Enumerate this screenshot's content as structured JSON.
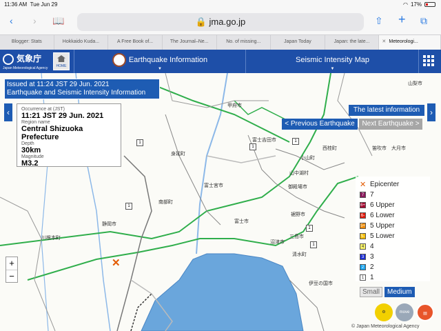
{
  "status_bar": {
    "time": "11:36 AM",
    "date": "Tue Jun 29",
    "battery": "17%"
  },
  "browser": {
    "url": "jma.go.jp",
    "tabs": [
      {
        "label": "Blogger: Stats"
      },
      {
        "label": "Hokkaido Kuda..."
      },
      {
        "label": "A Free Book of..."
      },
      {
        "label": "The Journal–Ne..."
      },
      {
        "label": "No. of missing..."
      },
      {
        "label": "Japan Today"
      },
      {
        "label": "Japan: the late..."
      },
      {
        "label": "Meteorologi..."
      }
    ]
  },
  "header": {
    "logo_name": "気象庁",
    "logo_sub": "Japan Meteorological Agency",
    "home_label": "HOME",
    "nav_earthquake": "Earthquake Information",
    "nav_intensity": "Seismic Intensity Map"
  },
  "issued": {
    "line1": "Issued at 11:24 JST 29 Jun. 2021",
    "line2": "Earthquake and Seismic Intensity Information"
  },
  "quake": {
    "occurrence_label": "Occurrence at (JST)",
    "occurrence_value": "11:21 JST 29 Jun. 2021",
    "region_label": "Region name",
    "region_value": "Central Shizuoka Prefecture",
    "depth_label": "Depth",
    "depth_value": "30km",
    "magnitude_label": "Magnitude",
    "magnitude_value": "M3.2"
  },
  "controls": {
    "latest": "The latest information",
    "previous": "< Previous Earthquake",
    "next": "Next Earthquake >",
    "size_small": "Small",
    "size_medium": "Medium",
    "zoom_in": "+",
    "zoom_out": "−",
    "move_tool": "move"
  },
  "legend": {
    "epicenter": "Epicenter",
    "items": [
      {
        "label": "7",
        "color": "#8a1a5c",
        "code": "7"
      },
      {
        "label": "6 Upper",
        "color": "#a2002a",
        "code": "6+"
      },
      {
        "label": "6 Lower",
        "color": "#e3190b",
        "code": "6-"
      },
      {
        "label": "5 Upper",
        "color": "#f08a00",
        "code": "5+"
      },
      {
        "label": "5 Lower",
        "color": "#f5bc00",
        "code": "5-"
      },
      {
        "label": "4",
        "color": "#f8f36a",
        "code": "4"
      },
      {
        "label": "3",
        "color": "#1d2fd6",
        "code": "3"
      },
      {
        "label": "2",
        "color": "#1aa5f0",
        "code": "2"
      },
      {
        "label": "1",
        "color": "#ffffff",
        "code": "1"
      }
    ]
  },
  "map": {
    "copyright": "© Japan Meteorological Agency",
    "places": [
      "川根本町",
      "静岡市",
      "富士市",
      "富士宮市",
      "南部町",
      "富士吉田市",
      "身延町",
      "山中湖村",
      "裾野市",
      "御殿場市",
      "沼津市",
      "三島市",
      "伊豆の国市",
      "清水町",
      "小山町",
      "甲府市",
      "山梨市",
      "大月市",
      "笛吹市",
      "西桂町"
    ],
    "station_intensity": "1"
  }
}
